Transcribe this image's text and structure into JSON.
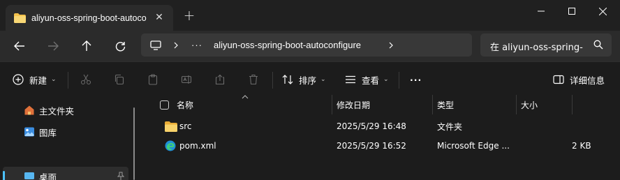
{
  "window": {
    "tab_title": "aliyun-oss-spring-boot-autoconfigure",
    "tab_close": "✕",
    "new_tab": "+"
  },
  "nav": {
    "breadcrumb": [
      "aliyun-oss-spring-boot-autoconfigure"
    ],
    "overflow": "···",
    "search_placeholder": "在 aliyun-oss-spring-"
  },
  "toolbar": {
    "new_label": "新建",
    "sort_label": "排序",
    "view_label": "查看",
    "more": "···",
    "details_label": "详细信息"
  },
  "sidebar": {
    "items": [
      {
        "label": "主文件夹",
        "icon": "home-icon"
      },
      {
        "label": "图库",
        "icon": "gallery-icon"
      },
      {
        "label": "桌面",
        "icon": "desktop-icon"
      }
    ]
  },
  "list": {
    "columns": [
      "名称",
      "修改日期",
      "类型",
      "大小"
    ],
    "rows": [
      {
        "name": "src",
        "date": "2025/5/29 16:48",
        "type": "文件夹",
        "size": "",
        "icon": "folder-icon"
      },
      {
        "name": "pom.xml",
        "date": "2025/5/29 16:52",
        "type": "Microsoft Edge ...",
        "size": "2 KB",
        "icon": "edge-icon"
      }
    ]
  },
  "colors": {
    "accent": "#4cc2ff",
    "folder": "#f3c14b",
    "background": "#1c1c1c",
    "titlebar": "#202020",
    "navbar": "#2b2b2b"
  }
}
